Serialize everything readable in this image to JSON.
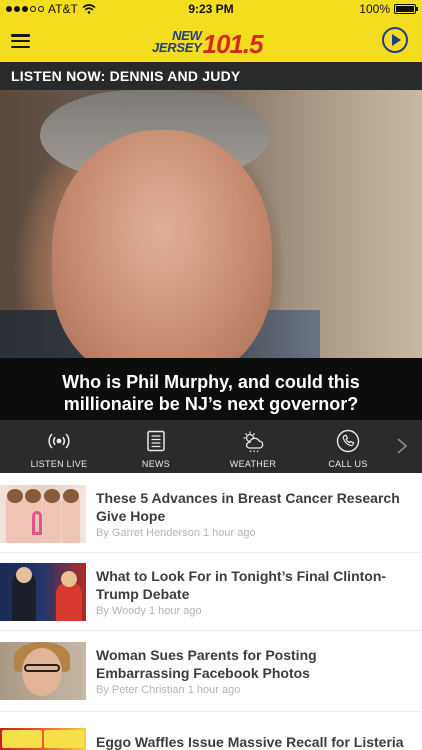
{
  "status_bar": {
    "carrier": "AT&T",
    "time": "9:23 PM",
    "battery": "100%"
  },
  "header": {
    "menu_icon": "hamburger-icon",
    "logo_line1": "NEW",
    "logo_line2": "JERSEY",
    "logo_freq": "101.5",
    "play_icon": "play-icon",
    "colors": {
      "bar": "#f4dc1e",
      "logo_blue": "#1e3f8f",
      "logo_red": "#d52b1e"
    }
  },
  "listen_now": "LISTEN NOW: DENNIS AND JUDY",
  "carousel": {
    "slide_count": 7,
    "active_index": 0,
    "caption": "Who is Phil Murphy, and could this millionaire be NJ’s next governor?"
  },
  "nav": {
    "items": [
      {
        "label": "LISTEN LIVE",
        "icon": "broadcast-icon"
      },
      {
        "label": "NEWS",
        "icon": "newspaper-icon"
      },
      {
        "label": "WEATHER",
        "icon": "weather-icon"
      },
      {
        "label": "CALL US",
        "icon": "phone-icon"
      }
    ],
    "more_icon": "chevron-right-icon"
  },
  "articles": [
    {
      "title": "These 5 Advances in Breast Cancer Research Give Hope",
      "author": "By Garret Henderson",
      "time": "1 hour ago"
    },
    {
      "title": "What to Look For in Tonight’s Final Clinton-Trump Debate",
      "author": "By Woody",
      "time": "1 hour ago"
    },
    {
      "title": "Woman Sues Parents for Posting Embarrassing Facebook Photos",
      "author": "By Peter Christian",
      "time": "1 hour ago"
    },
    {
      "title": "Eggo Waffles Issue Massive Recall for Listeria"
    }
  ]
}
